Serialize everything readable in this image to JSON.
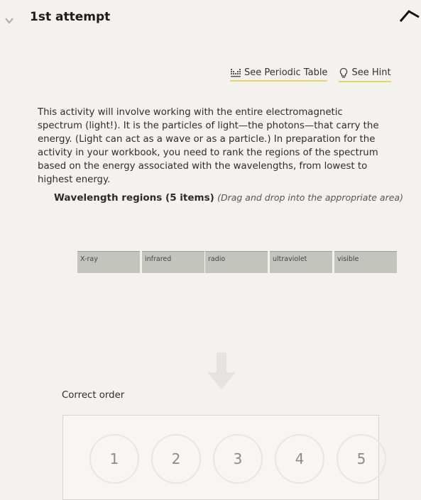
{
  "attempt": {
    "title": "1st attempt"
  },
  "toolbar": {
    "periodic_table_label": "See Periodic Table",
    "hint_label": "See Hint"
  },
  "instructions": "This activity will involve working with the entire electromagnetic spectrum (light!). It is the particles of light—the photons—that carry the energy. (Light can act as a wave or as a particle.) In preparation for the activity in your workbook, you need to rank the regions of the spectrum based on the energy associated with the wavelengths, from lowest to highest energy.",
  "items_section": {
    "heading": "Wavelength regions (5 items)",
    "hint": "(Drag and drop into the appropriate area)",
    "items": [
      "X-ray",
      "infrared",
      "radio",
      "ultraviolet",
      "visible"
    ]
  },
  "correct_order": {
    "label": "Correct order",
    "slots": [
      "1",
      "2",
      "3",
      "4",
      "5"
    ]
  },
  "colors": {
    "item_fill": "#c4c4bf",
    "link_underline": "#e2d76a",
    "background": "#f3f2ef"
  }
}
